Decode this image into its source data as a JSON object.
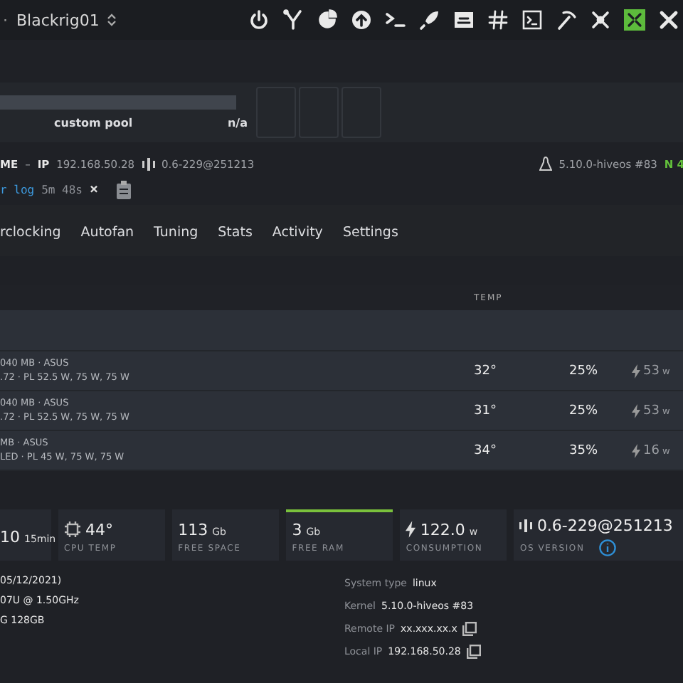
{
  "top_bar": {
    "separator": "·",
    "rig_name": "Blackrig01",
    "tools": [
      {
        "kind": "power",
        "on": false
      },
      {
        "kind": "fork",
        "on": false
      },
      {
        "kind": "pie",
        "on": false
      },
      {
        "kind": "upload",
        "on": false
      },
      {
        "kind": "terminal",
        "on": false
      },
      {
        "kind": "rocket",
        "on": false
      },
      {
        "kind": "screen",
        "on": false
      },
      {
        "kind": "hash",
        "on": false
      },
      {
        "kind": "console",
        "on": false
      },
      {
        "kind": "pickaxe",
        "on": false
      },
      {
        "kind": "network",
        "on": false
      },
      {
        "kind": "grid",
        "on": true
      },
      {
        "kind": "tools",
        "on": false
      }
    ]
  },
  "pool": {
    "name": "custom pool",
    "value": "n/a"
  },
  "info": {
    "name_cut": "ME",
    "dash": "–",
    "ip_label": "IP",
    "ip": "192.168.50.28",
    "version": "0.6-229@251213",
    "kernel": "5.10.0-hiveos #83",
    "extra": "N 4"
  },
  "log": {
    "text": "r log",
    "time": "5m 48s",
    "close": "×"
  },
  "tabs": [
    {
      "label": "rclocking",
      "selected": false
    },
    {
      "label": "Autofan",
      "selected": false
    },
    {
      "label": "Tuning",
      "selected": false
    },
    {
      "label": "Stats",
      "selected": false
    },
    {
      "label": "Activity",
      "selected": false
    },
    {
      "label": "Settings",
      "selected": false
    }
  ],
  "table": {
    "temp_column": "TEMP",
    "rows": [
      {
        "line1": "040 MB · ASUS",
        "line2": ".72 · PL 52.5 W, 75 W, 75 W",
        "temp": "32°",
        "fan": "25%",
        "power": "53",
        "unit": "w"
      },
      {
        "line1": "040 MB · ASUS",
        "line2": ".72 · PL 52.5 W, 75 W, 75 W",
        "temp": "31°",
        "fan": "25%",
        "power": "53",
        "unit": "w"
      },
      {
        "line1": " MB · ASUS",
        "line2": "LED · PL 45 W, 75 W, 75 W",
        "temp": "34°",
        "fan": "35%",
        "power": "16",
        "unit": "w"
      }
    ]
  },
  "stats": [
    {
      "kind": "plain",
      "value": "10",
      "unit": "15min",
      "highlight": false
    },
    {
      "kind": "cpu",
      "value": "44°",
      "label": "CPU TEMP",
      "highlight": false
    },
    {
      "kind": "plain",
      "value": "113",
      "unit": "Gb",
      "label": "FREE SPACE",
      "highlight": false
    },
    {
      "kind": "plain",
      "value": "3",
      "unit": "Gb",
      "label": "FREE RAM",
      "highlight": true
    },
    {
      "kind": "bolt",
      "value": "122.0",
      "unit": "w",
      "label": "CONSUMPTION",
      "highlight": false
    },
    {
      "kind": "version",
      "value": "0.6-229@251213",
      "label": "OS VERSION",
      "highlight": false
    }
  ],
  "system": {
    "left": [
      "05/12/2021)",
      "07U @ 1.50GHz",
      "G 128GB"
    ],
    "right": [
      {
        "label": "System type",
        "value": "linux",
        "copy": false
      },
      {
        "label": "Kernel",
        "value": "5.10.0-hiveos #83",
        "copy": false
      },
      {
        "label": "Remote IP",
        "value": "xx.xxx.xx.x",
        "copy": true
      },
      {
        "label": "Local IP",
        "value": "192.168.50.28",
        "copy": true
      }
    ]
  }
}
